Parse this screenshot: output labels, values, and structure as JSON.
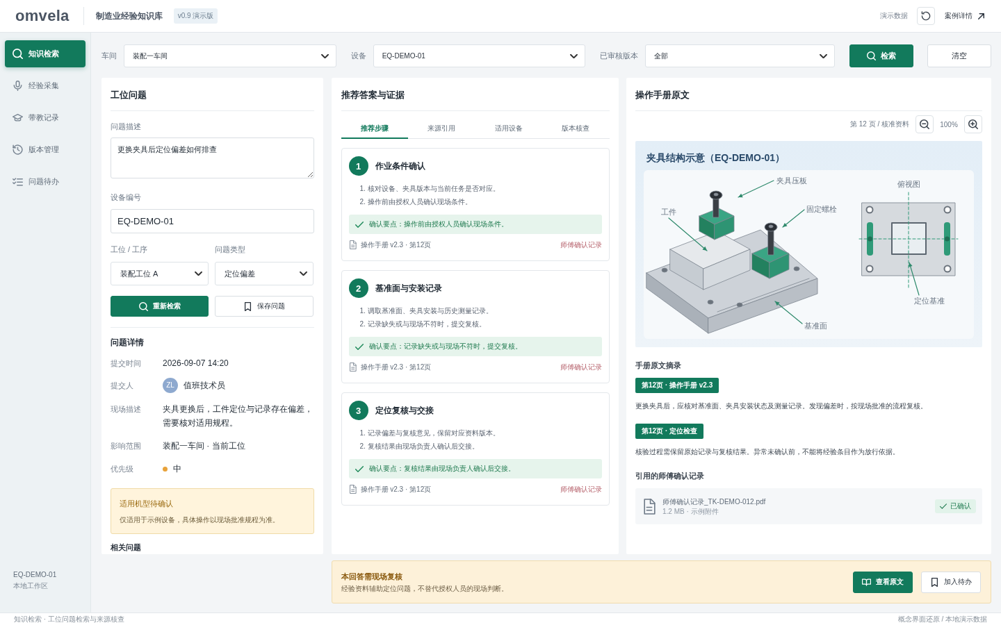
{
  "header": {
    "logo": "omvela",
    "title": "制造业经验知识库",
    "version_badge": "v0.9 演示版",
    "demo_label": "演示数据",
    "case_link": "案例详情"
  },
  "sidebar": {
    "items": [
      {
        "kind": "search",
        "label": "知识检索",
        "selected": true
      },
      {
        "kind": "capture",
        "label": "经验采集",
        "selected": false
      },
      {
        "kind": "mentoring",
        "label": "带教记录",
        "selected": false
      },
      {
        "kind": "versions",
        "label": "版本管理",
        "selected": false
      },
      {
        "kind": "todo",
        "label": "问题待办",
        "selected": false
      }
    ],
    "device": "EQ-DEMO-01",
    "workspace": "本地工作区"
  },
  "filters": {
    "fields": [
      {
        "label": "车间",
        "value": "装配一车间"
      },
      {
        "label": "设备",
        "value": "EQ-DEMO-01"
      },
      {
        "label": "已审核版本",
        "value": "全部"
      }
    ],
    "search_button": "检索",
    "clear_button": "清空"
  },
  "question_panel": {
    "title": "工位问题",
    "description_label": "问题描述",
    "description": "更换夹具后定位偏差如何排查",
    "device_label": "设备编号",
    "device": "EQ-DEMO-01",
    "station_label": "工位 / 工序",
    "station": "装配工位 A",
    "type_label": "问题类型",
    "type": "定位偏差",
    "research_button": "重新检索",
    "save_button": "保存问题",
    "details_title": "问题详情",
    "details": [
      {
        "kind": "text",
        "label": "提交时间",
        "value": "2026-09-07 14:20"
      },
      {
        "kind": "person",
        "label": "提交人",
        "avatar": "ZL",
        "value": "值班技术员"
      },
      {
        "kind": "text",
        "label": "现场描述",
        "value": "夹具更换后，工件定位与记录存在偏差，需要核对适用规程。"
      },
      {
        "kind": "text",
        "label": "影响范围",
        "value": "装配一车间 · 当前工位"
      },
      {
        "kind": "priority",
        "label": "优先级",
        "value": "中"
      }
    ],
    "notice": {
      "title": "适用机型待确认",
      "text": "仅适用于示例设备，具体操作以现场批准规程为准。"
    },
    "related_title": "相关问题"
  },
  "answer_panel": {
    "title": "推荐答案与证据",
    "tabs": [
      {
        "label": "推荐步骤",
        "selected": true
      },
      {
        "label": "来源引用",
        "selected": false
      },
      {
        "label": "适用设备",
        "selected": false
      },
      {
        "label": "版本核查",
        "selected": false
      }
    ],
    "steps": [
      {
        "number": "1",
        "title": "作业条件确认",
        "items": [
          "1. 核对设备、夹具版本与当前任务是否对应。",
          "2. 操作前由授权人员确认现场条件。"
        ],
        "checkpoint": "确认要点：操作前由授权人员确认现场条件。",
        "source": "操作手册 v2.3 · 第12页",
        "record_link": "师傅确认记录"
      },
      {
        "number": "2",
        "title": "基准面与安装记录",
        "items": [
          "1. 调取基准面、夹具安装与历史测量记录。",
          "2. 记录缺失或与现场不符时，提交复核。"
        ],
        "checkpoint": "确认要点：记录缺失或与现场不符时，提交复核。",
        "source": "操作手册 v2.3 · 第12页",
        "record_link": "师傅确认记录"
      },
      {
        "number": "3",
        "title": "定位复核与交接",
        "items": [
          "1. 记录偏差与复核意见，保留对应资料版本。",
          "2. 复核结果由现场负责人确认后交接。"
        ],
        "checkpoint": "确认要点：复核结果由现场负责人确认后交接。",
        "source": "操作手册 v2.3 · 第12页",
        "record_link": "师傅确认记录"
      }
    ]
  },
  "manual_panel": {
    "title": "操作手册原文",
    "page_info": "第 12 页 / 核准资料",
    "zoom_level": "100%",
    "figure": {
      "title": "夹具结构示意（EQ-DEMO-01）",
      "labels": [
        "夹具压板",
        "俯视图",
        "工件",
        "固定螺栓",
        "定位基准",
        "基准面"
      ]
    },
    "excerpt_title": "手册原文摘录",
    "excerpts": [
      {
        "tag": "第12页 · 操作手册 v2.3",
        "text": "更换夹具后，应核对基准面、夹具安装状态及测量记录。发现偏差时，按现场批准的流程复核。"
      },
      {
        "tag": "第12页 · 定位检查",
        "text": "核验过程需保留原始记录与复核结果。异常未确认前，不能将经验条目作为放行依据。"
      }
    ],
    "records_title": "引用的师傅确认记录",
    "records": [
      {
        "name": "师傅确认记录_TK-DEMO-012.pdf",
        "meta": "1.2 MB · 示例附件",
        "status": "已确认",
        "confirmed": true
      }
    ]
  },
  "review_bar": {
    "title": "本回答需现场复核",
    "text": "经验资料辅助定位问题，不替代授权人员的现场判断。",
    "view_button": "查看原文",
    "todo_button": "加入待办"
  },
  "footer": {
    "breadcrumb": "知识检索 · 工位问题检索与来源核查",
    "note": "概念界面还原 / 本地演示数据"
  }
}
